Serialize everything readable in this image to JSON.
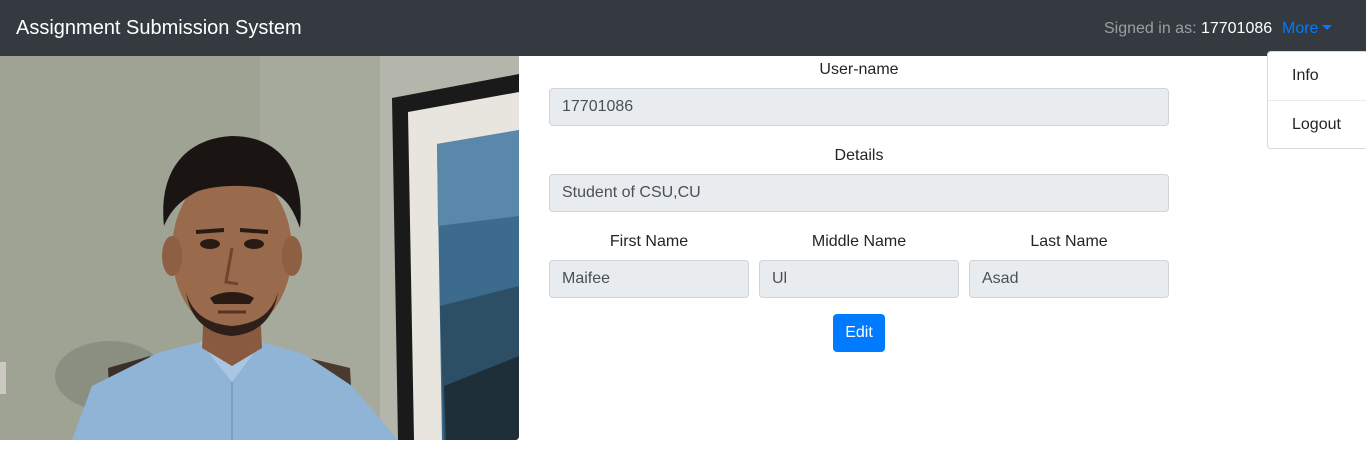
{
  "navbar": {
    "brand": "Assignment Submission System",
    "signed_in_label": "Signed in as: ",
    "signed_in_user": "17701086",
    "more_label": "More"
  },
  "dropdown": {
    "items": [
      "Info",
      "Logout"
    ]
  },
  "profile": {
    "photo_icon": "profile-photo",
    "username_label": "User-name",
    "username_value": "17701086",
    "details_label": "Details",
    "details_value": "Student of CSU,CU",
    "first_name_label": "First Name",
    "first_name_value": "Maifee",
    "middle_name_label": "Middle Name",
    "middle_name_value": "Ul",
    "last_name_label": "Last Name",
    "last_name_value": "Asad",
    "edit_label": "Edit"
  },
  "colors": {
    "navbar_bg": "#343a40",
    "accent": "#007bff",
    "input_bg": "#e9ecef"
  }
}
